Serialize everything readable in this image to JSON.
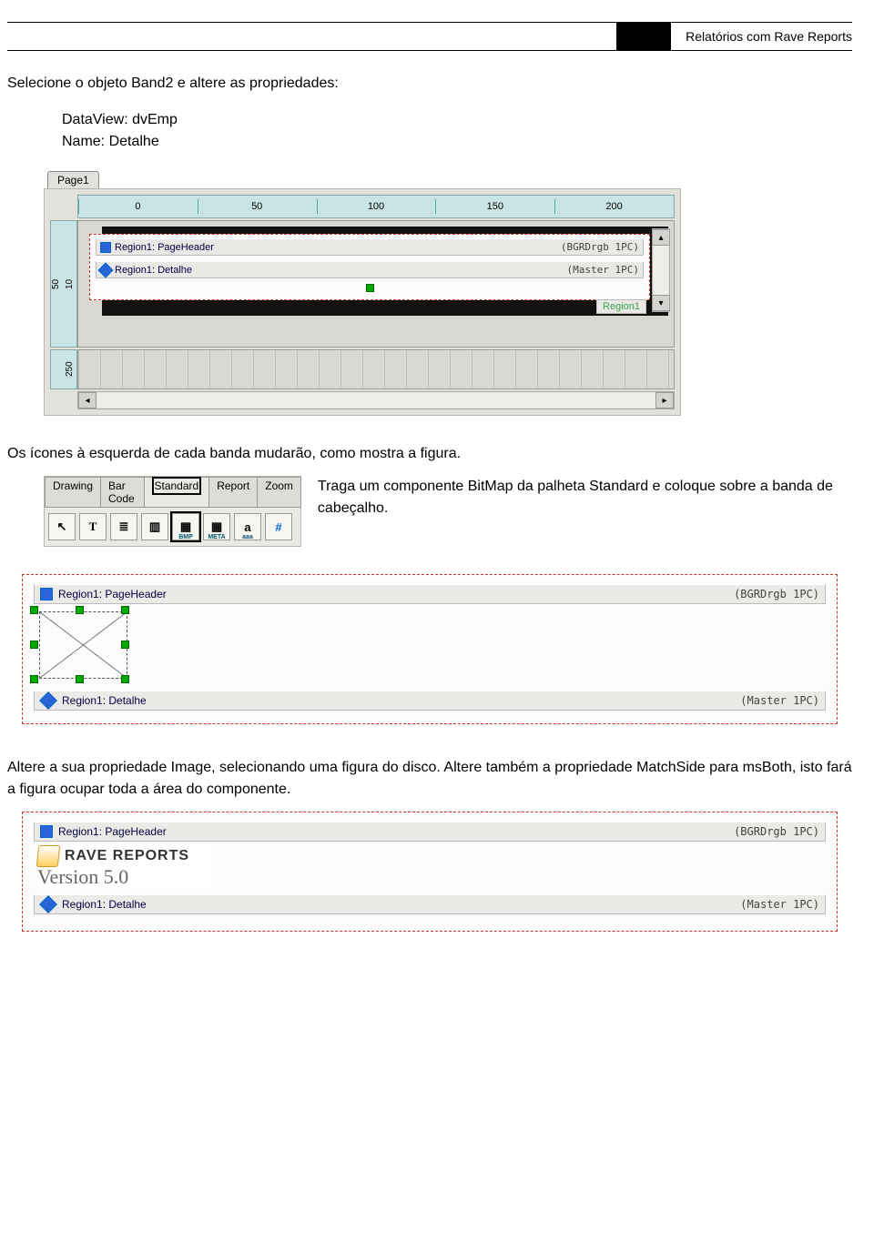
{
  "header": {
    "title": "Relatórios com Rave Reports"
  },
  "intro": "Selecione o objeto Band2 e altere as propriedades:",
  "props": {
    "dataview_label": "DataView: dvEmp",
    "name_label": "Name: Detalhe"
  },
  "shot1": {
    "page_tab": "Page1",
    "hruler": [
      "0",
      "50",
      "100",
      "150",
      "200"
    ],
    "vruler_top": [
      "10",
      "50"
    ],
    "vruler_bot": "250",
    "band1_name": "Region1: PageHeader",
    "band1_flags": "(BGRDrgb 1PC)",
    "band2_name": "Region1: Detalhe",
    "band2_flags": "(Master 1PC)",
    "region_label": "Region1"
  },
  "mid_text": "Os ícones à esquerda de cada banda mudarão, como mostra a figura.",
  "palette": {
    "tabs": [
      "Drawing",
      "Bar Code",
      "Standard",
      "Report",
      "Zoom"
    ],
    "active_tab": "Standard",
    "tool_cursor": "↖",
    "tool_text_T": "T",
    "tool_memo": "≣",
    "tool_section": "▥",
    "tool_bmp": "BMP",
    "tool_meta": "META",
    "tool_font_a": "a",
    "tool_font_sub": "aaa",
    "tool_hash": "#"
  },
  "palette_text": "Traga um componente BitMap da palheta Standard e coloque sobre a banda de cabeçalho.",
  "shot2": {
    "band1_name": "Region1: PageHeader",
    "band1_flags": "(BGRDrgb 1PC)",
    "band2_name": "Region1: Detalhe",
    "band2_flags": "(Master 1PC)"
  },
  "para2": "Altere a sua propriedade Image, selecionando uma figura do disco. Altere também a propriedade MatchSide para msBoth, isto fará a figura ocupar toda a área do componente.",
  "shot3": {
    "band1_name": "Region1: PageHeader",
    "band1_flags": "(BGRDrgb 1PC)",
    "brand": "RAVE REPORTS",
    "version": "Version 5.0",
    "band2_name": "Region1: Detalhe",
    "band2_flags": "(Master 1PC)"
  }
}
